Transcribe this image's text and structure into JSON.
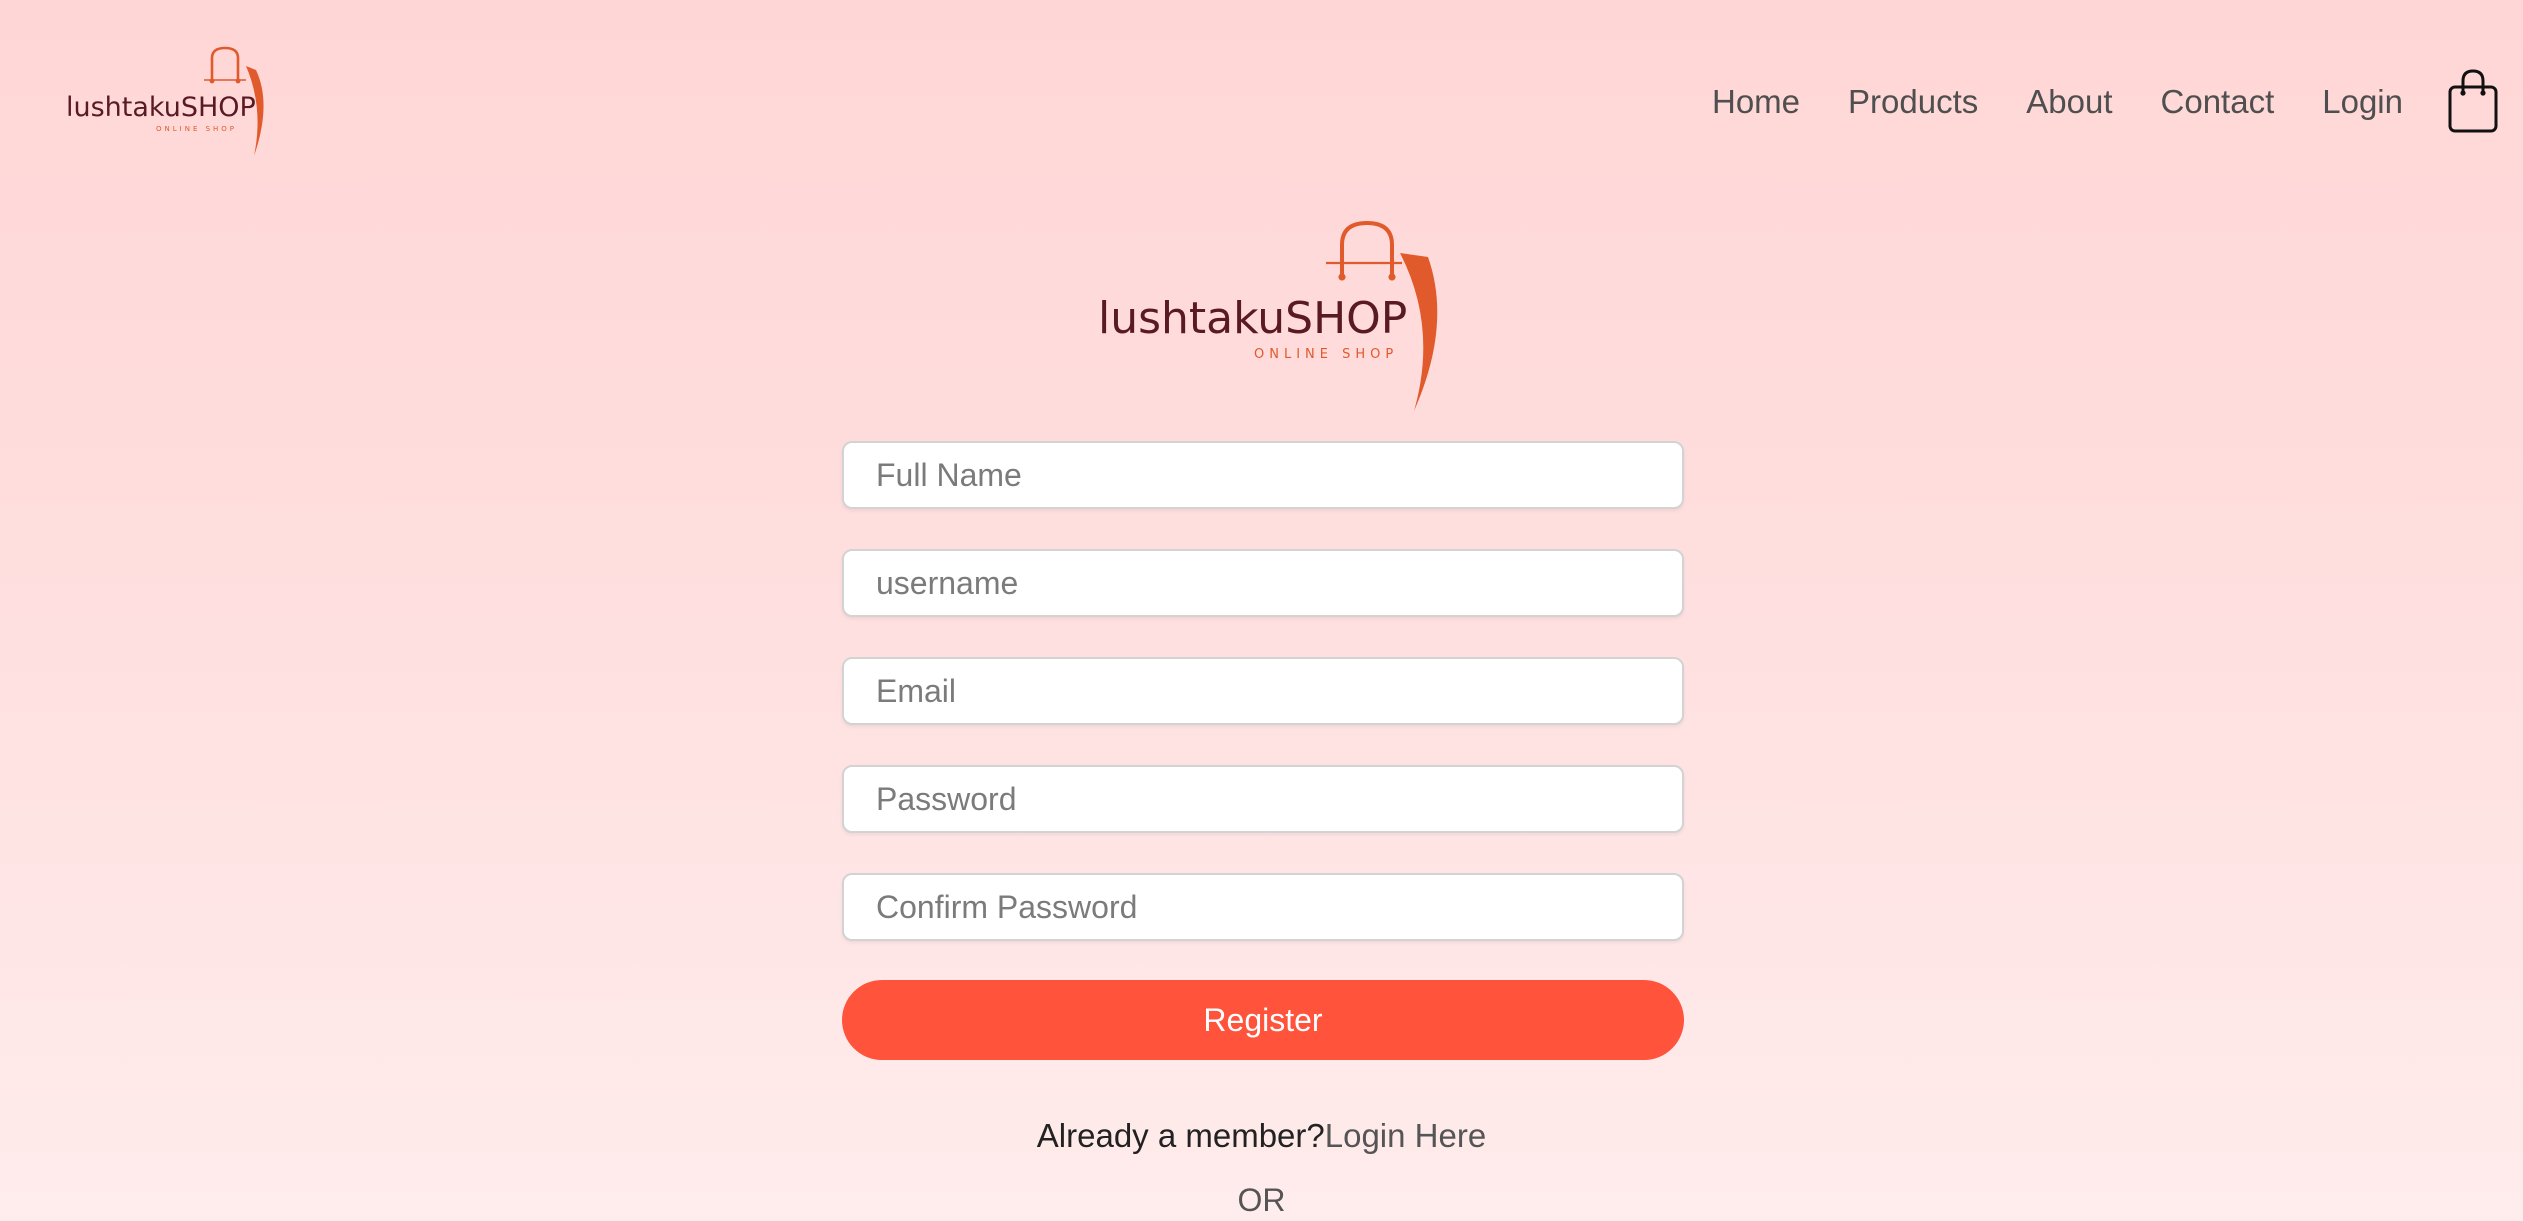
{
  "brand": {
    "name": "lushtakuSHOP",
    "tagline": "ONLINE SHOP",
    "colors": {
      "accent": "#ff533b",
      "logo_text": "#5a1a25",
      "logo_bag": "#e05a2b"
    }
  },
  "nav": {
    "items": [
      {
        "label": "Home"
      },
      {
        "label": "Products"
      },
      {
        "label": "About"
      },
      {
        "label": "Contact"
      },
      {
        "label": "Login"
      }
    ],
    "cart_icon": "shopping-bag-icon"
  },
  "form": {
    "full_name": {
      "placeholder": "Full Name",
      "value": ""
    },
    "username": {
      "placeholder": "username",
      "value": ""
    },
    "email": {
      "placeholder": "Email",
      "value": ""
    },
    "password": {
      "placeholder": "Password",
      "value": ""
    },
    "confirm_password": {
      "placeholder": "Confirm Password",
      "value": ""
    },
    "register_label": "Register"
  },
  "footer": {
    "member_text": "Already a member?",
    "login_link": "Login Here",
    "or_text": "OR"
  }
}
